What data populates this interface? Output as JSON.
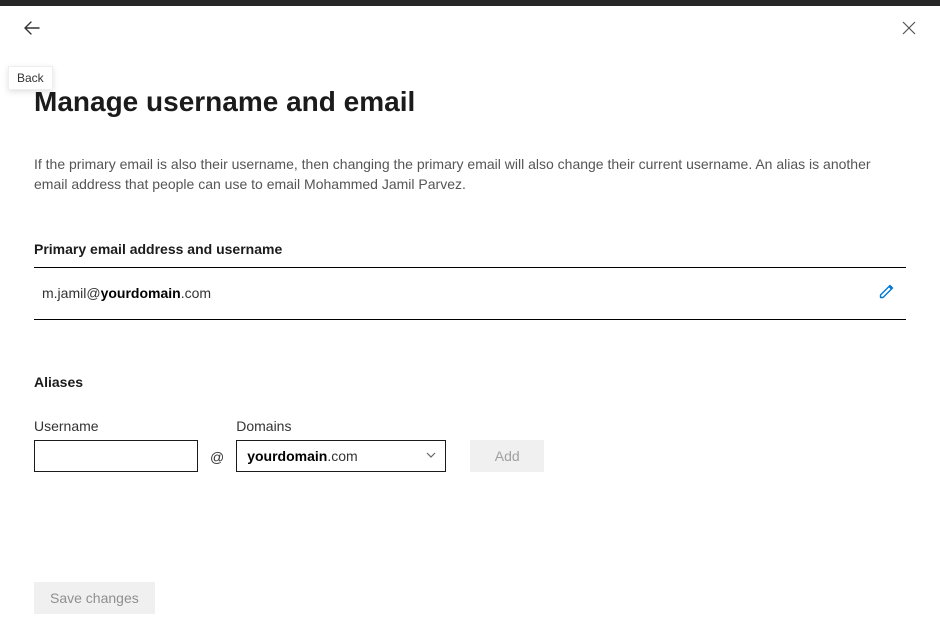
{
  "header": {
    "back_tooltip": "Back"
  },
  "page_title": "Manage username and email",
  "description": "If the primary email is also their username, then changing the primary email will also change their current username. An alias is another email address that people can use to email Mohammed Jamil Parvez.",
  "primary_section": {
    "label": "Primary email address and username",
    "email_local": "m.jamil",
    "email_domain": "yourdomain",
    "email_tld": ".com"
  },
  "aliases_section": {
    "label": "Aliases",
    "username_label": "Username",
    "domains_label": "Domains",
    "at_symbol": "@",
    "username_value": "",
    "selected_domain": "yourdomain",
    "selected_tld": ".com",
    "add_button_label": "Add"
  },
  "footer": {
    "save_button_label": "Save changes"
  }
}
